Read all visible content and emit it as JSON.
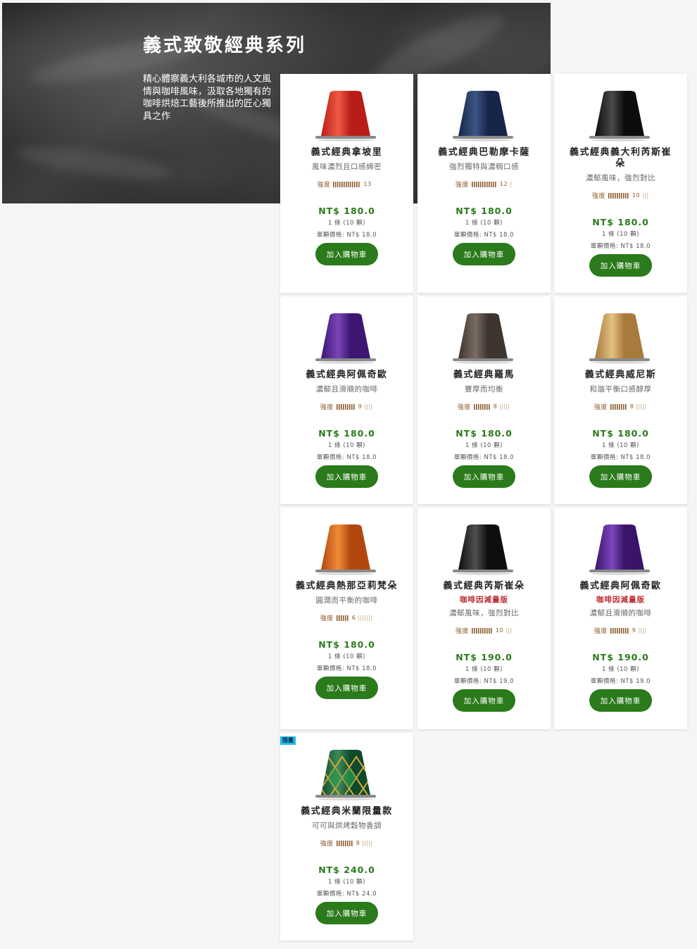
{
  "hero": {
    "title": "義式致敬經典系列",
    "description": "精心體察義大利各城市的人文風情與咖啡風味，汲取各地獨有的咖啡烘焙工藝後所推出的匠心獨具之作"
  },
  "labels": {
    "intensity": "強度",
    "add_to_cart": "加入購物車"
  },
  "products": [
    {
      "name": "義式經典拿坡里",
      "decaf": "",
      "desc": "風味濃烈且口感綿密",
      "intensity": "13",
      "intensity_level": 13,
      "price": "NT$ 180.0",
      "qty": "1 條 (10 顆)",
      "unit": "單顆價格: NT$ 18.0",
      "badge": "",
      "cap_color": "#b81d17",
      "cap_highlight": "#ee5a45"
    },
    {
      "name": "義式經典巴勒摩卡薩",
      "decaf": "",
      "desc": "強烈獨特與濃稠口感",
      "intensity": "12",
      "intensity_level": 12,
      "price": "NT$ 180.0",
      "qty": "1 條 (10 顆)",
      "unit": "單顆價格: NT$ 18.0",
      "badge": "",
      "cap_color": "#18254a",
      "cap_highlight": "#3c5585"
    },
    {
      "name": "義式經典義大利芮斯崔朵",
      "decaf": "",
      "desc": "濃郁風味，強烈對比",
      "intensity": "10",
      "intensity_level": 10,
      "price": "NT$ 180.0",
      "qty": "1 條 (10 顆)",
      "unit": "單顆價格: NT$ 18.0",
      "badge": "",
      "cap_color": "#0c0c0c",
      "cap_highlight": "#4a4a4a"
    },
    {
      "name": "義式經典阿佩奇歐",
      "decaf": "",
      "desc": "濃郁且滑順的咖啡",
      "intensity": "9",
      "intensity_level": 9,
      "price": "NT$ 180.0",
      "qty": "1 條 (10 顆)",
      "unit": "單顆價格: NT$ 18.0",
      "badge": "",
      "cap_color": "#3c1670",
      "cap_highlight": "#7a45b8"
    },
    {
      "name": "義式經典羅馬",
      "decaf": "",
      "desc": "豐厚而均衡",
      "intensity": "8",
      "intensity_level": 8,
      "price": "NT$ 180.0",
      "qty": "1 條 (10 顆)",
      "unit": "單顆價格: NT$ 18.0",
      "badge": "",
      "cap_color": "#3e3530",
      "cap_highlight": "#7a6c62"
    },
    {
      "name": "義式經典威尼斯",
      "decaf": "",
      "desc": "和諧平衡口感醇厚",
      "intensity": "8",
      "intensity_level": 8,
      "price": "NT$ 180.0",
      "qty": "1 條 (10 顆)",
      "unit": "單顆價格: NT$ 18.0",
      "badge": "",
      "cap_color": "#a87a3c",
      "cap_highlight": "#e3c083"
    },
    {
      "name": "義式經典熱那亞莉梵朵",
      "decaf": "",
      "desc": "圓潤而平衡的咖啡",
      "intensity": "6",
      "intensity_level": 6,
      "price": "NT$ 180.0",
      "qty": "1 條 (10 顆)",
      "unit": "單顆價格: NT$ 18.0",
      "badge": "",
      "cap_color": "#b2470e",
      "cap_highlight": "#f08a3a"
    },
    {
      "name": "義式經典芮斯崔朵",
      "decaf": "咖啡因減量版",
      "desc": "濃郁風味，強烈對比",
      "intensity": "10",
      "intensity_level": 10,
      "price": "NT$ 190.0",
      "qty": "1 條 (10 顆)",
      "unit": "單顆價格: NT$ 19.0",
      "badge": "",
      "cap_color": "#0e0e0e",
      "cap_highlight": "#505050"
    },
    {
      "name": "義式經典阿佩奇歐",
      "decaf": "咖啡因減量版",
      "desc": "濃郁且滑順的咖啡",
      "intensity": "9",
      "intensity_level": 9,
      "price": "NT$ 190.0",
      "qty": "1 條 (10 顆)",
      "unit": "單顆價格: NT$ 19.0",
      "badge": "",
      "cap_color": "#3a1468",
      "cap_highlight": "#7c48bc"
    },
    {
      "name": "義式經典米蘭限量款",
      "decaf": "",
      "desc": "可可與烘烤穀物香調",
      "intensity": "8",
      "intensity_level": 8,
      "price": "NT$ 240.0",
      "qty": "1 條 (10 顆)",
      "unit": "單顆價格: NT$ 24.0",
      "badge": "限量",
      "cap_color": "#0f4a2c",
      "cap_highlight": "#3f8a5a"
    }
  ]
}
